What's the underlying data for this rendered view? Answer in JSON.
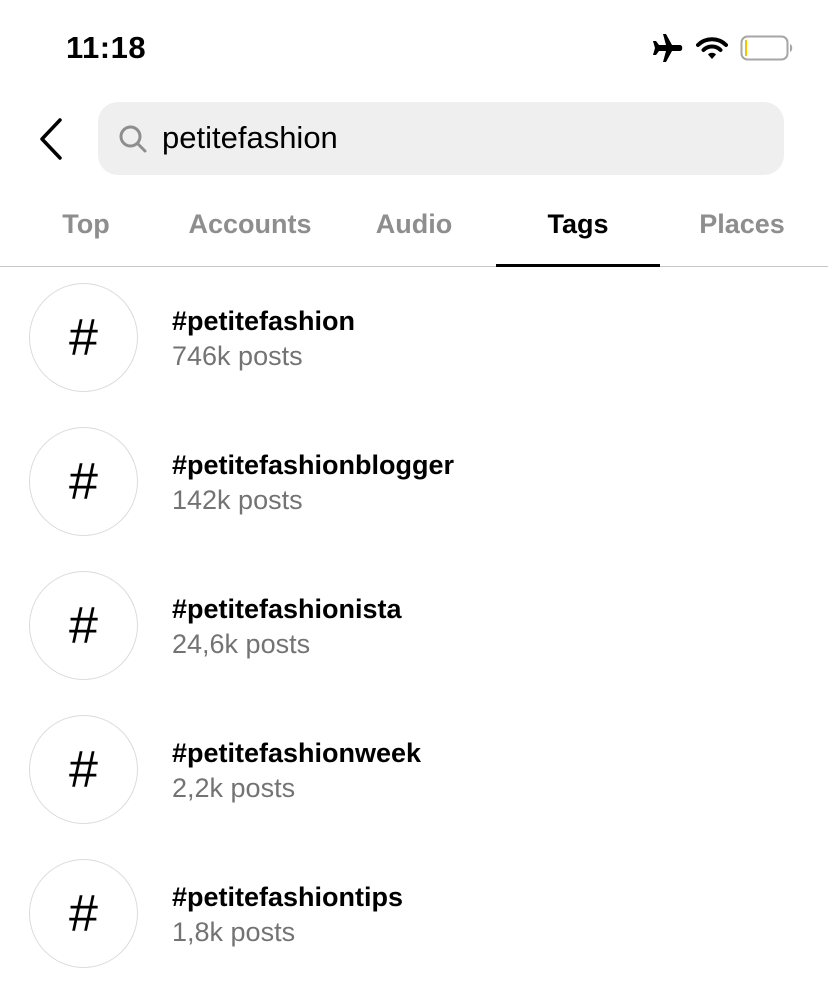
{
  "status_bar": {
    "time": "11:18",
    "icons": [
      "airplane-mode-icon",
      "wifi-icon",
      "battery-icon"
    ],
    "battery_level_percent": 5,
    "battery_color": "#f5c400"
  },
  "search": {
    "back_icon": "chevron-left-icon",
    "search_icon": "search-icon",
    "value": "petitefashion"
  },
  "tabs": [
    {
      "label": "Top",
      "active": false
    },
    {
      "label": "Accounts",
      "active": false
    },
    {
      "label": "Audio",
      "active": false
    },
    {
      "label": "Tags",
      "active": true
    },
    {
      "label": "Places",
      "active": false
    }
  ],
  "results": [
    {
      "icon": "#",
      "name": "#petitefashion",
      "count": "746k posts"
    },
    {
      "icon": "#",
      "name": "#petitefashionblogger",
      "count": "142k posts"
    },
    {
      "icon": "#",
      "name": "#petitefashionista",
      "count": "24,6k posts"
    },
    {
      "icon": "#",
      "name": "#petitefashionweek",
      "count": "2,2k posts"
    },
    {
      "icon": "#",
      "name": "#petitefashiontips",
      "count": "1,8k posts"
    }
  ]
}
